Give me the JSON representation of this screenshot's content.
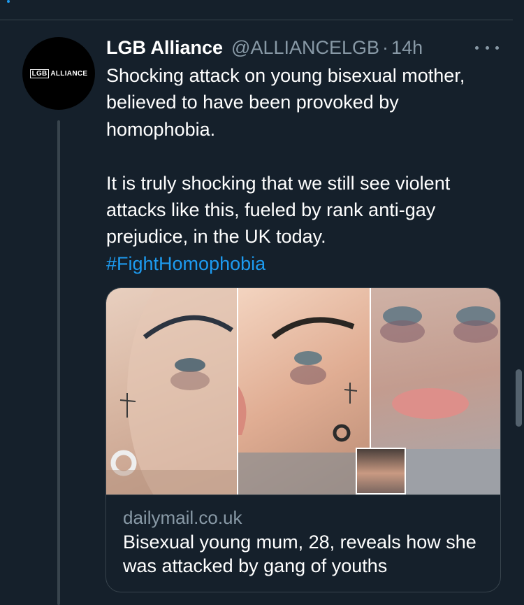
{
  "tweet": {
    "author_name": "LGB Alliance",
    "handle": "@ALLIANCELGB",
    "separator": "·",
    "time": "14h",
    "avatar_logo": {
      "boxed": "LGB",
      "text": "ALLIANCE"
    },
    "paragraphs": [
      "Shocking attack on young bisexual mother, believed to have been provoked by homophobia.",
      "It is truly shocking that we still see violent attacks like this, fueled by rank anti-gay prejudice, in the UK today."
    ],
    "hashtag": "#FightHomophobia"
  },
  "card": {
    "domain": "dailymail.co.uk",
    "title": "Bisexual young mum, 28, reveals how she was attacked by gang of youths"
  },
  "icons": {
    "more": "more-options-icon"
  },
  "colors": {
    "background": "#15202b",
    "link": "#1d9bf0",
    "secondary_text": "#8899a6",
    "border": "#38444d"
  }
}
